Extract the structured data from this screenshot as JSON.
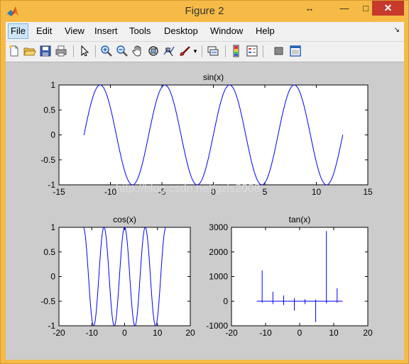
{
  "window": {
    "title": "Figure 2",
    "controls": {
      "restore": "↔",
      "minimize": "—",
      "maximize": "□",
      "close": "✕"
    }
  },
  "menu": {
    "items": [
      {
        "label": "File"
      },
      {
        "label": "Edit"
      },
      {
        "label": "View"
      },
      {
        "label": "Insert"
      },
      {
        "label": "Tools"
      },
      {
        "label": "Desktop"
      },
      {
        "label": "Window"
      },
      {
        "label": "Help"
      }
    ]
  },
  "toolbar": {
    "icons": [
      "new-figure-icon",
      "open-file-icon",
      "save-icon",
      "print-icon",
      "pointer-icon",
      "zoom-in-icon",
      "zoom-out-icon",
      "pan-icon",
      "rotate-3d-icon",
      "data-cursor-icon",
      "brush-icon",
      "link-plot-icon",
      "colorbar-icon",
      "legend-icon",
      "hide-plot-tools-icon",
      "show-plot-tools-icon"
    ]
  },
  "watermark": "http://blog.csdn.net/gzls2008",
  "colors": {
    "line": "#0000ff",
    "axes_bg": "#ffffff",
    "figure_bg": "#cccccc"
  },
  "chart_data": [
    {
      "type": "line",
      "title": "sin(x)",
      "function": "sin",
      "x_range": [
        -12.57,
        12.57
      ],
      "xlim": [
        -15,
        15
      ],
      "ylim": [
        -1,
        1
      ],
      "xticks": [
        -15,
        -10,
        -5,
        0,
        5,
        10,
        15
      ],
      "yticks": [
        -1,
        -0.5,
        0,
        0.5,
        1
      ],
      "xtick_labels": [
        "-15",
        "-10",
        "-5",
        "0",
        "5",
        "10",
        "15"
      ],
      "ytick_labels": [
        "-1",
        "-0.5",
        "0",
        "0.5",
        "1"
      ]
    },
    {
      "type": "line",
      "title": "cos(x)",
      "function": "cos",
      "x_range": [
        -12.57,
        12.57
      ],
      "xlim": [
        -20,
        20
      ],
      "ylim": [
        -1,
        1
      ],
      "xticks": [
        -20,
        -10,
        0,
        10,
        20
      ],
      "yticks": [
        -1,
        -0.5,
        0,
        0.5,
        1
      ],
      "xtick_labels": [
        "-20",
        "-10",
        "0",
        "10",
        "20"
      ],
      "ytick_labels": [
        "-1",
        "-0.5",
        "0",
        "0.5",
        "1"
      ]
    },
    {
      "type": "line",
      "title": "tan(x)",
      "function": "tan",
      "x_range": [
        -12.57,
        12.57
      ],
      "xlim": [
        -20,
        20
      ],
      "ylim": [
        -1000,
        3000
      ],
      "xticks": [
        -20,
        -10,
        0,
        10,
        20
      ],
      "yticks": [
        -1000,
        0,
        1000,
        2000,
        3000
      ],
      "xtick_labels": [
        "-20",
        "-10",
        "0",
        "10",
        "20"
      ],
      "ytick_labels": [
        "-1000",
        "0",
        "1000",
        "2000",
        "3000"
      ],
      "spikes": [
        {
          "x": -11.0,
          "y": 1250
        },
        {
          "x": -10.99,
          "y": -60
        },
        {
          "x": -7.85,
          "y": 380
        },
        {
          "x": -7.84,
          "y": -120
        },
        {
          "x": -4.7,
          "y": 230
        },
        {
          "x": -4.69,
          "y": -160
        },
        {
          "x": -1.57,
          "y": 120
        },
        {
          "x": -1.56,
          "y": -380
        },
        {
          "x": 1.57,
          "y": 80
        },
        {
          "x": 1.58,
          "y": -120
        },
        {
          "x": 4.71,
          "y": -850
        },
        {
          "x": 4.72,
          "y": 60
        },
        {
          "x": 7.85,
          "y": 2850
        },
        {
          "x": 7.86,
          "y": -90
        },
        {
          "x": 10.99,
          "y": 520
        },
        {
          "x": 11.0,
          "y": -60
        }
      ]
    }
  ]
}
